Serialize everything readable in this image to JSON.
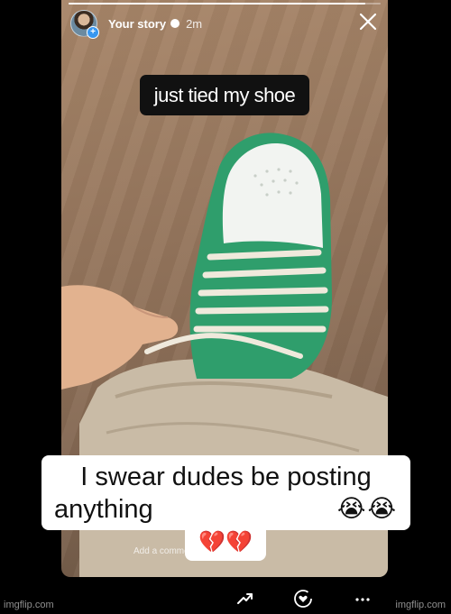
{
  "story": {
    "username": "Your story",
    "time_ago": "2m",
    "progress": 0.95,
    "caption": "just tied my shoe",
    "comment_placeholder": "Add a comment..."
  },
  "meme": {
    "line1": "I swear dudes be posting",
    "line2": "anything",
    "crying_emojis": "😭😭",
    "heart_emojis": "💔💔"
  },
  "icons": {
    "close": "close-icon",
    "share": "trending-arrow-icon",
    "activity": "heart-activity-icon",
    "more": "more-dots-icon"
  },
  "watermark": {
    "left": "imgflip.com",
    "right": "imgflip.com"
  },
  "colors": {
    "shoe_green": "#2f9e6c",
    "accent_blue": "#3897f0"
  }
}
